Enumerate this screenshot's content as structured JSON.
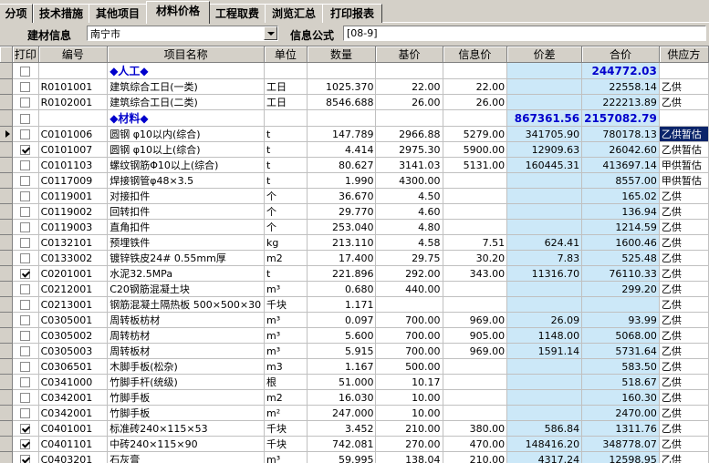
{
  "tabs": [
    {
      "label": "分项",
      "active": false
    },
    {
      "label": "技术措施",
      "active": false
    },
    {
      "label": "其他项目",
      "active": false
    },
    {
      "label": "材料价格",
      "active": true
    },
    {
      "label": "工程取费",
      "active": false
    },
    {
      "label": "浏览汇总",
      "active": false
    },
    {
      "label": "打印报表",
      "active": false
    }
  ],
  "toolbar": {
    "material_info_label": "建材信息",
    "city_value": "南宁市",
    "info_formula_label": "信息公式",
    "formula_value": "[08-9]"
  },
  "columns": [
    "打印",
    "编号",
    "项目名称",
    "单位",
    "数量",
    "基价",
    "信息价",
    "价差",
    "合价",
    "供应方"
  ],
  "rows": [
    {
      "type": "group",
      "print": false,
      "code": "",
      "name": "◆人工◆",
      "unit": "",
      "qty": "",
      "base": "",
      "info": "",
      "diff": "",
      "total": "244772.03",
      "supplier": ""
    },
    {
      "print": false,
      "code": "R0101001",
      "name": "建筑综合工日(一类)",
      "unit": "工日",
      "qty": "1025.370",
      "base": "22.00",
      "info": "22.00",
      "diff": "",
      "total": "22558.14",
      "supplier": "乙供"
    },
    {
      "print": false,
      "code": "R0102001",
      "name": "建筑综合工日(二类)",
      "unit": "工日",
      "qty": "8546.688",
      "base": "26.00",
      "info": "26.00",
      "diff": "",
      "total": "222213.89",
      "supplier": "乙供"
    },
    {
      "type": "group",
      "print": false,
      "code": "",
      "name": "◆材料◆",
      "unit": "",
      "qty": "",
      "base": "",
      "info": "",
      "diff": "867361.56",
      "total": "2157082.79",
      "supplier": ""
    },
    {
      "current": true,
      "print": false,
      "code": "C0101006",
      "name": "圆钢 φ10以内(综合)",
      "unit": "t",
      "qty": "147.789",
      "base": "2966.88",
      "info": "5279.00",
      "diff": "341705.90",
      "total": "780178.13",
      "supplier": "乙供暂估",
      "selSupplier": true
    },
    {
      "print": true,
      "code": "C0101007",
      "name": "圆钢 φ10以上(综合)",
      "unit": "t",
      "qty": "4.414",
      "base": "2975.30",
      "info": "5900.00",
      "diff": "12909.63",
      "total": "26042.60",
      "supplier": "乙供暂估"
    },
    {
      "print": false,
      "code": "C0101103",
      "name": "螺纹钢筋Φ10以上(综合)",
      "unit": "t",
      "qty": "80.627",
      "base": "3141.03",
      "info": "5131.00",
      "diff": "160445.31",
      "total": "413697.14",
      "supplier": "甲供暂估"
    },
    {
      "print": false,
      "code": "C0117009",
      "name": "焊接钢管φ48×3.5",
      "unit": "t",
      "qty": "1.990",
      "base": "4300.00",
      "info": "",
      "diff": "",
      "total": "8557.00",
      "supplier": "甲供暂估"
    },
    {
      "print": false,
      "code": "C0119001",
      "name": "对接扣件",
      "unit": "个",
      "qty": "36.670",
      "base": "4.50",
      "info": "",
      "diff": "",
      "total": "165.02",
      "supplier": "乙供"
    },
    {
      "print": false,
      "code": "C0119002",
      "name": "回转扣件",
      "unit": "个",
      "qty": "29.770",
      "base": "4.60",
      "info": "",
      "diff": "",
      "total": "136.94",
      "supplier": "乙供"
    },
    {
      "print": false,
      "code": "C0119003",
      "name": "直角扣件",
      "unit": "个",
      "qty": "253.040",
      "base": "4.80",
      "info": "",
      "diff": "",
      "total": "1214.59",
      "supplier": "乙供"
    },
    {
      "print": false,
      "code": "C0132101",
      "name": "预埋铁件",
      "unit": "kg",
      "qty": "213.110",
      "base": "4.58",
      "info": "7.51",
      "diff": "624.41",
      "total": "1600.46",
      "supplier": "乙供"
    },
    {
      "print": false,
      "code": "C0133002",
      "name": "镀锌铁皮24# 0.55mm厚",
      "unit": "m2",
      "qty": "17.400",
      "base": "29.75",
      "info": "30.20",
      "diff": "7.83",
      "total": "525.48",
      "supplier": "乙供"
    },
    {
      "print": true,
      "code": "C0201001",
      "name": "水泥32.5MPa",
      "unit": "t",
      "qty": "221.896",
      "base": "292.00",
      "info": "343.00",
      "diff": "11316.70",
      "total": "76110.33",
      "supplier": "乙供"
    },
    {
      "print": false,
      "code": "C0212001",
      "name": "C20钢筋混凝土块",
      "unit": "m³",
      "qty": "0.680",
      "base": "440.00",
      "info": "",
      "diff": "",
      "total": "299.20",
      "supplier": "乙供"
    },
    {
      "print": false,
      "code": "C0213001",
      "name": "钢筋混凝土隔热板 500×500×30",
      "unit": "千块",
      "qty": "1.171",
      "base": "",
      "info": "",
      "diff": "",
      "total": "",
      "supplier": "乙供"
    },
    {
      "print": false,
      "code": "C0305001",
      "name": "周转板枋材",
      "unit": "m³",
      "qty": "0.097",
      "base": "700.00",
      "info": "969.00",
      "diff": "26.09",
      "total": "93.99",
      "supplier": "乙供"
    },
    {
      "print": false,
      "code": "C0305002",
      "name": "周转枋材",
      "unit": "m³",
      "qty": "5.600",
      "base": "700.00",
      "info": "905.00",
      "diff": "1148.00",
      "total": "5068.00",
      "supplier": "乙供"
    },
    {
      "print": false,
      "code": "C0305003",
      "name": "周转板材",
      "unit": "m³",
      "qty": "5.915",
      "base": "700.00",
      "info": "969.00",
      "diff": "1591.14",
      "total": "5731.64",
      "supplier": "乙供"
    },
    {
      "print": false,
      "code": "C0306501",
      "name": "木脚手板(松杂)",
      "unit": "m3",
      "qty": "1.167",
      "base": "500.00",
      "info": "",
      "diff": "",
      "total": "583.50",
      "supplier": "乙供"
    },
    {
      "print": false,
      "code": "C0341000",
      "name": "竹脚手杆(统级)",
      "unit": "根",
      "qty": "51.000",
      "base": "10.17",
      "info": "",
      "diff": "",
      "total": "518.67",
      "supplier": "乙供"
    },
    {
      "print": false,
      "code": "C0342001",
      "name": "竹脚手板",
      "unit": "m2",
      "qty": "16.030",
      "base": "10.00",
      "info": "",
      "diff": "",
      "total": "160.30",
      "supplier": "乙供"
    },
    {
      "print": false,
      "code": "C0342001",
      "name": "竹脚手板",
      "unit": "m²",
      "qty": "247.000",
      "base": "10.00",
      "info": "",
      "diff": "",
      "total": "2470.00",
      "supplier": "乙供"
    },
    {
      "print": true,
      "code": "C0401001",
      "name": "标准砖240×115×53",
      "unit": "千块",
      "qty": "3.452",
      "base": "210.00",
      "info": "380.00",
      "diff": "586.84",
      "total": "1311.76",
      "supplier": "乙供"
    },
    {
      "print": true,
      "code": "C0401101",
      "name": "中砖240×115×90",
      "unit": "千块",
      "qty": "742.081",
      "base": "270.00",
      "info": "470.00",
      "diff": "148416.20",
      "total": "348778.07",
      "supplier": "乙供"
    },
    {
      "print": true,
      "code": "C0403201",
      "name": "石灰膏",
      "unit": "m³",
      "qty": "59.995",
      "base": "138.04",
      "info": "210.00",
      "diff": "4317.24",
      "total": "12598.95",
      "supplier": "乙供"
    }
  ]
}
